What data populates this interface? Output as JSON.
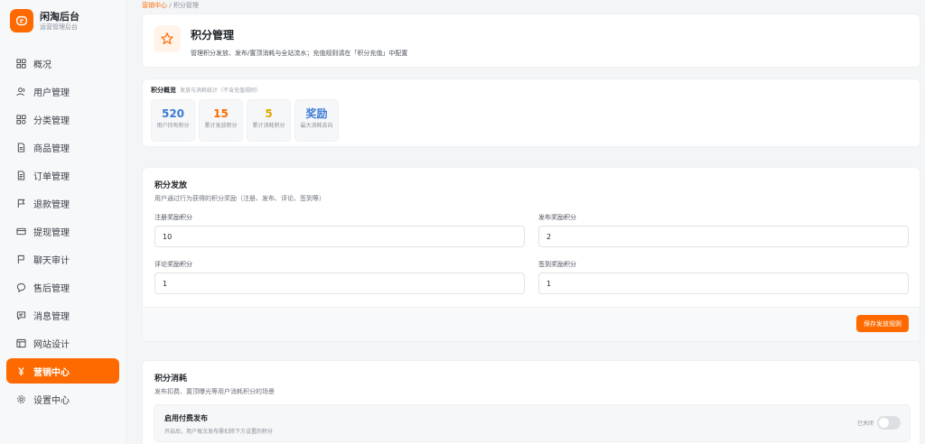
{
  "brand": {
    "title": "闲淘后台",
    "subtitle": "运营管理后台",
    "icon": "chat-bubble-icon"
  },
  "sidebar": {
    "items": [
      {
        "label": "概况",
        "icon": "grid-icon",
        "active": false
      },
      {
        "label": "用户管理",
        "icon": "users-icon",
        "active": false
      },
      {
        "label": "分类管理",
        "icon": "category-icon",
        "active": false
      },
      {
        "label": "商品管理",
        "icon": "document-icon",
        "active": false
      },
      {
        "label": "订单管理",
        "icon": "order-icon",
        "active": false
      },
      {
        "label": "退款管理",
        "icon": "flag-icon",
        "active": false
      },
      {
        "label": "提现管理",
        "icon": "wallet-icon",
        "active": false
      },
      {
        "label": "聊天审计",
        "icon": "flag-outline-icon",
        "active": false
      },
      {
        "label": "售后管理",
        "icon": "chat-icon",
        "active": false
      },
      {
        "label": "消息管理",
        "icon": "message-icon",
        "active": false
      },
      {
        "label": "网站设计",
        "icon": "layout-icon",
        "active": false
      },
      {
        "label": "营销中心",
        "icon": "yen-icon",
        "active": true
      },
      {
        "label": "设置中心",
        "icon": "gear-icon",
        "active": false
      }
    ]
  },
  "breadcrumb": {
    "parent": "营销中心",
    "separator": "/",
    "current": "积分管理"
  },
  "header": {
    "title": "积分管理",
    "description": "管理积分发放、发布/置顶消耗与全站流水；充值规则请在「积分充值」中配置",
    "icon": "star-icon"
  },
  "overview": {
    "title": "积分概览",
    "subtitle": "发放与消耗统计（不含充值规则）",
    "stats": [
      {
        "value": "520",
        "label": "用户持有积分",
        "color": "#3b7bd4"
      },
      {
        "value": "15",
        "label": "累计发放积分",
        "color": "#ff6a00"
      },
      {
        "value": "5",
        "label": "累计消耗积分",
        "color": "#e0a800"
      },
      {
        "value": "奖励",
        "label": "最大消耗去向",
        "color": "#3b7bd4"
      }
    ]
  },
  "issuance": {
    "title": "积分发放",
    "subtitle": "用户通过行为获得的积分奖励（注册、发布、评论、签到等）",
    "fields": [
      {
        "label": "注册奖励积分",
        "value": "10"
      },
      {
        "label": "发布奖励积分",
        "value": "2"
      },
      {
        "label": "评论奖励积分",
        "value": "1"
      },
      {
        "label": "签到奖励积分",
        "value": "1"
      }
    ],
    "save_label": "保存发放规则"
  },
  "consumption": {
    "title": "积分消耗",
    "subtitle": "发布扣费、置顶曝光等用户消耗积分的场景",
    "toggle": {
      "title": "启用付费发布",
      "description": "开启后，用户每次发布需扣除下方设置的积分",
      "state_label": "已关闭",
      "enabled": false
    }
  },
  "colors": {
    "accent": "#ff6a00",
    "background": "#f4f5f7"
  }
}
